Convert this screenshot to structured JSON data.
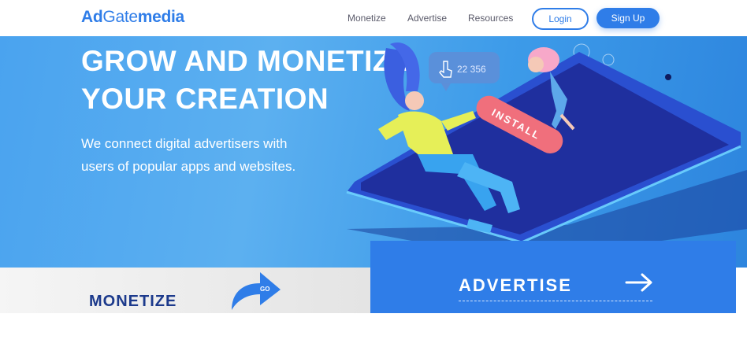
{
  "header": {
    "logo": {
      "part1": "Ad",
      "part2": "Gate",
      "part3": "media"
    },
    "nav": [
      "Monetize",
      "Advertise",
      "Resources"
    ],
    "login": "Login",
    "signup": "Sign Up"
  },
  "hero": {
    "headline_line1": "GROW AND MONETIZE",
    "headline_line2": "YOUR CREATION",
    "subline_line1": "We connect digital advertisers with",
    "subline_line2": "users of popular apps and websites.",
    "illustration": {
      "counter": "22 356",
      "install_button": "INSTALL"
    }
  },
  "monetize": {
    "label": "MONETIZE",
    "go": "GO"
  },
  "advertise": {
    "label": "ADVERTISE"
  },
  "colors": {
    "brand": "#2f7de8",
    "hero": "#4aa3ef",
    "dark_blue": "#1c3a8c",
    "install": "#f06f7c"
  }
}
